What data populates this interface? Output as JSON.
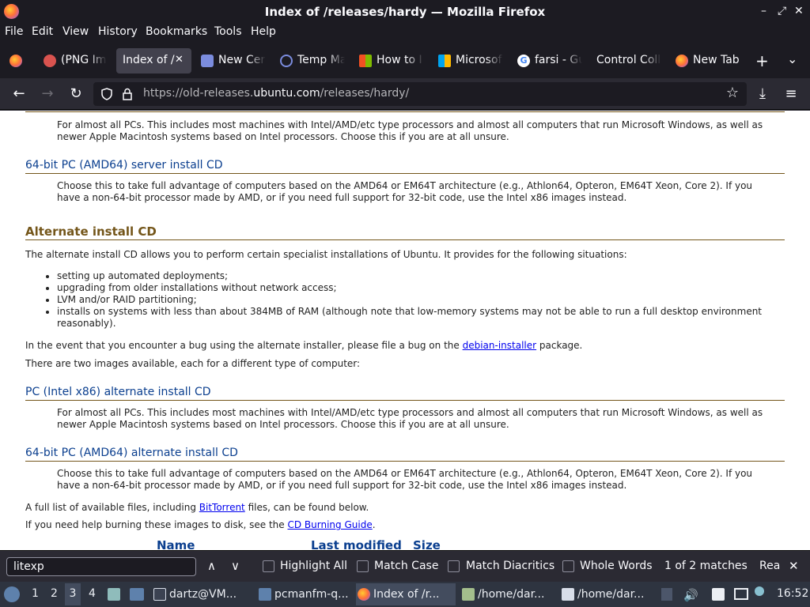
{
  "window": {
    "title": "Index of /releases/hardy — Mozilla Firefox",
    "minimize": "–",
    "maximize": "⤢",
    "close": "✕"
  },
  "menu": [
    "File",
    "Edit",
    "View",
    "History",
    "Bookmarks",
    "Tools",
    "Help"
  ],
  "tabs": [
    {
      "label": "(PNG Im",
      "icon_color": "#d9534f"
    },
    {
      "label": "Index of /",
      "icon_color": "",
      "active": true
    },
    {
      "label": "New Cer",
      "icon_color": "#7b8cde"
    },
    {
      "label": "Temp Ma",
      "icon_color": "#7b8cde"
    },
    {
      "label": "How to I",
      "icon_color": "#f25022"
    },
    {
      "label": "Microsof",
      "icon_color": "#00a4ef"
    },
    {
      "label": "farsi - Gu",
      "icon_color": "#ffffff"
    },
    {
      "label": "Control Coll",
      "icon_color": ""
    },
    {
      "label": "New Tab",
      "icon_color": "#ff7139"
    }
  ],
  "tab_close": "✕",
  "new_tab": "+",
  "tab_list": "⌄",
  "nav": {
    "back": "←",
    "forward": "→",
    "reload": "↻",
    "url_prefix": "https://old-releases.",
    "url_domain": "ubuntu.com",
    "url_suffix": "/releases/hardy/",
    "bookmark": "☆",
    "download": "⤓",
    "menu": "≡"
  },
  "content": {
    "desc1": "For almost all PCs. This includes most machines with Intel/AMD/etc type processors and almost all computers that run Microsoft Windows, as well as newer Apple Macintosh systems based on Intel processors. Choose this if you are at all unsure.",
    "link_amd64_server": "64-bit PC (AMD64) server install CD",
    "desc2": "Choose this to take full advantage of computers based on the AMD64 or EM64T architecture (e.g., Athlon64, Opteron, EM64T Xeon, Core 2). If you have a non-64-bit processor made by AMD, or if you need full support for 32-bit code, use the Intel x86 images instead.",
    "heading_alternate": "Alternate install CD",
    "alt_intro": "The alternate install CD allows you to perform certain specialist installations of Ubuntu. It provides for the following situations:",
    "bullets": [
      "setting up automated deployments;",
      "upgrading from older installations without network access;",
      "LVM and/or RAID partitioning;",
      "installs on systems with less than about 384MB of RAM (although note that low-memory systems may not be able to run a full desktop environment reasonably)."
    ],
    "bug_pre": "In the event that you encounter a bug using the alternate installer, please file a bug on the ",
    "bug_link": "debian-installer",
    "bug_post": " package.",
    "two_images": "There are two images available, each for a different type of computer:",
    "link_x86_alt": "PC (Intel x86) alternate install CD",
    "desc3": "For almost all PCs. This includes most machines with Intel/AMD/etc type processors and almost all computers that run Microsoft Windows, as well as newer Apple Macintosh systems based on Intel processors. Choose this if you are at all unsure.",
    "link_amd64_alt": "64-bit PC (AMD64) alternate install CD",
    "desc4": "Choose this to take full advantage of computers based on the AMD64 or EM64T architecture (e.g., Athlon64, Opteron, EM64T Xeon, Core 2). If you have a non-64-bit processor made by AMD, or if you need full support for 32-bit code, use the Intel x86 images instead.",
    "full_list_pre": "A full list of available files, including ",
    "full_list_link": "BitTorrent",
    "full_list_post": " files, can be found below.",
    "burn_pre": "If you need help burning these images to disk, see the ",
    "burn_link": "CD Burning Guide",
    "burn_post": ".",
    "col_name": "Name",
    "col_modified": "Last modified",
    "col_size": "Size"
  },
  "findbar": {
    "query": "litexp",
    "prev": "∧",
    "next": "∨",
    "highlight_all": "Highlight All",
    "match_case": "Match Case",
    "match_diacritics": "Match Diacritics",
    "whole_words": "Whole Words",
    "status": "1 of 2 matches",
    "reached": "Rea",
    "close": "✕"
  },
  "taskbar": {
    "workspaces": [
      "1",
      "2",
      "3",
      "4"
    ],
    "active_workspace": "3",
    "tasks": [
      {
        "label": "dartz@VM...",
        "icon_color": "#3b4252"
      },
      {
        "label": "pcmanfm-q...",
        "icon_color": "#5e81ac"
      },
      {
        "label": "Index of /r...",
        "icon_color": "#ff7139",
        "active": true
      },
      {
        "label": "/home/dar...",
        "icon_color": "#a3be8c"
      },
      {
        "label": "/home/dar...",
        "icon_color": "#d8dee9"
      }
    ],
    "clock": "16:52"
  }
}
